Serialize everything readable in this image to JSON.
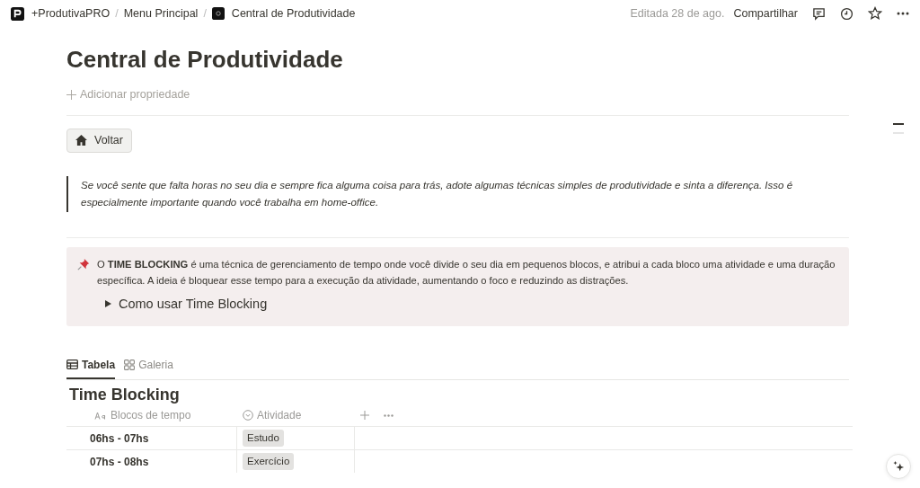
{
  "breadcrumbs": [
    {
      "label": "+ProdutivaPRO"
    },
    {
      "separator": "/",
      "label": "Menu Principal"
    },
    {
      "separator": "/",
      "label": "Central de Produtividade"
    }
  ],
  "topbar": {
    "edited": "Editada 28 de ago.",
    "share": "Compartilhar"
  },
  "page": {
    "title": "Central de Produtividade",
    "add_property": "Adicionar propriedade",
    "back_button": "Voltar",
    "quote": "Se você sente que falta horas no seu dia e sempre fica alguma coisa para trás, adote algumas técnicas simples de produtividade e sinta a diferença. Isso é especialmente importante quando você trabalha em home-office.",
    "callout": {
      "text": "O **TIME BLOCKING** é uma técnica de gerenciamento de tempo onde você divide o seu dia em pequenos blocos, e atribui a cada bloco uma atividade e uma duração específica. A ideia é bloquear esse tempo para a execução da atividade, aumentando o foco e reduzindo as distrações.",
      "toggle": {
        "label": "Como usar Time Blocking",
        "expanded": false
      }
    }
  },
  "views": [
    {
      "label": "Tabela",
      "kind": "table",
      "selected": true
    },
    {
      "label": "Galeria",
      "kind": "gallery",
      "selected": false
    }
  ],
  "database": {
    "title": "Time Blocking",
    "columns": [
      {
        "label": "Blocos de tempo",
        "kind": "title"
      },
      {
        "label": "Atividade",
        "kind": "select"
      }
    ],
    "rows": [
      {
        "block": "06hs - 07hs",
        "activity": "Estudo"
      },
      {
        "block": "07hs - 08hs",
        "activity": "Exercício"
      }
    ]
  }
}
